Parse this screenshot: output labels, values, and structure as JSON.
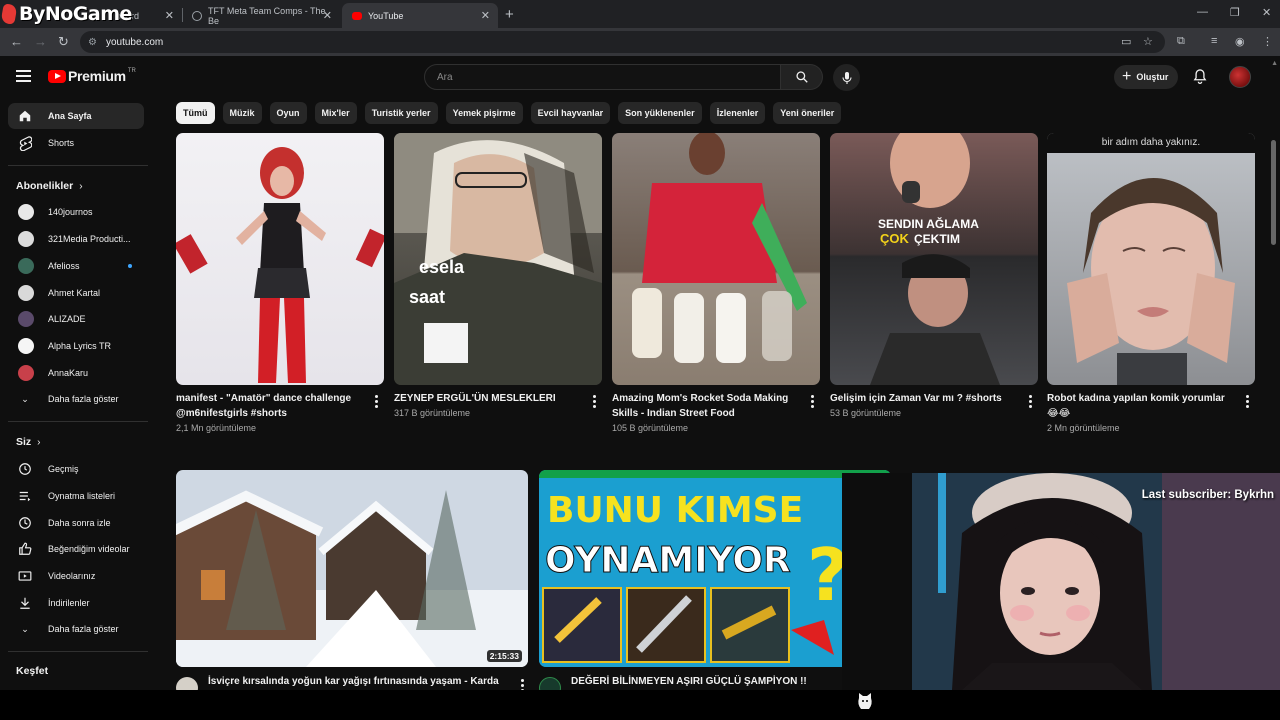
{
  "overlay": {
    "watermark": "ByNoGame",
    "webcam_text": "Last subscriber: Bykrhn"
  },
  "browser": {
    "tabs": [
      {
        "label": "board"
      },
      {
        "label": "TFT Meta Team Comps - The Be"
      },
      {
        "label": "YouTube"
      }
    ],
    "url": "youtube.com"
  },
  "header": {
    "logo_text": "Premium",
    "logo_superscript": "TR",
    "search_placeholder": "Ara",
    "create_label": "Oluştur"
  },
  "sidebar": {
    "main": [
      {
        "label": "Ana Sayfa",
        "icon": "home-icon"
      },
      {
        "label": "Shorts",
        "icon": "shorts-icon"
      }
    ],
    "subscriptions_title": "Abonelikler",
    "subscriptions": [
      {
        "label": "140journos",
        "color": "#e8e8e8"
      },
      {
        "label": "321Media Producti...",
        "color": "#dcdcdc"
      },
      {
        "label": "Afelioss",
        "color": "#3a6a5a"
      },
      {
        "label": "Ahmet Kartal",
        "color": "#d9d9d9"
      },
      {
        "label": "ALIZADE",
        "color": "#5a4a6a"
      },
      {
        "label": "Alpha Lyrics TR",
        "color": "#f5f5f5"
      },
      {
        "label": "AnnaKaru",
        "color": "#c8404a"
      }
    ],
    "show_more_subs": "Daha fazla göster",
    "you_title": "Siz",
    "you_items": [
      {
        "label": "Geçmiş",
        "icon": "history-icon"
      },
      {
        "label": "Oynatma listeleri",
        "icon": "playlists-icon"
      },
      {
        "label": "Daha sonra izle",
        "icon": "watch-later-icon"
      },
      {
        "label": "Beğendiğim videolar",
        "icon": "liked-icon"
      },
      {
        "label": "Videolarınız",
        "icon": "your-videos-icon"
      },
      {
        "label": "İndirilenler",
        "icon": "downloads-icon"
      }
    ],
    "show_more_you": "Daha fazla göster",
    "explore_title": "Keşfet"
  },
  "chips": [
    "Tümü",
    "Müzik",
    "Oyun",
    "Mix'ler",
    "Turistik yerler",
    "Yemek pişirme",
    "Evcil hayvanlar",
    "Son yüklenenler",
    "İzlenenler",
    "Yeni öneriler"
  ],
  "shorts": [
    {
      "title_line1": "manifest - \"Amatör\" dance challenge",
      "title_line2": "@m6nifestgirls #shorts",
      "views": "2,1 Mn görüntüleme",
      "overlay": ""
    },
    {
      "title_line1": "ZEYNEP ERGÜL'ÜN MESLEKLERI",
      "title_line2": "",
      "views": "317 B görüntüleme",
      "overlay": "esela saat"
    },
    {
      "title_line1": "Amazing Mom's Rocket Soda Making",
      "title_line2": "Skills - Indian Street Food",
      "views": "105 B görüntüleme",
      "overlay": ""
    },
    {
      "title_line1": "Gelişim için Zaman Var mı ?  #shorts",
      "title_line2": "",
      "views": "53 B görüntüleme",
      "overlay": "SENDIN AĞLAMA ÇOK ÇEKTIM"
    },
    {
      "title_line1": "Robot kadına yapılan komik yorumlar",
      "title_line2": "😂😂",
      "views": "2 Mn görüntüleme",
      "overlay": "bir adım daha yakınız."
    }
  ],
  "videos": [
    {
      "title": "İsviçre kırsalında yoğun kar yağışı fırtınasında yaşam - Karda",
      "duration": "2:15:33"
    },
    {
      "title": "DEĞERİ BİLİNMEYEN AŞIRI GÜÇLÜ ŞAMPİYON !!",
      "thumb_text_1": "BUNU KIMSE",
      "thumb_text_2": "OYNAMIYOR"
    }
  ],
  "colors": {
    "bg": "#0f0f0f",
    "chip": "#272727",
    "brand_red": "#ff0000",
    "subtext": "#aaaaaa"
  }
}
